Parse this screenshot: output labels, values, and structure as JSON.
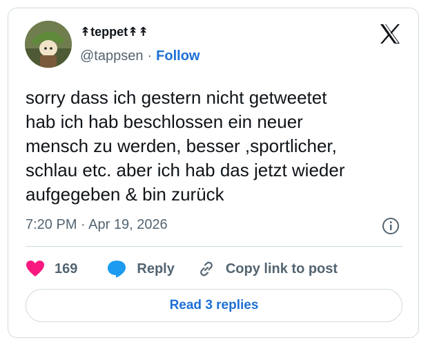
{
  "author": {
    "display_name": "↟teppet↟↟",
    "handle": "@tappsen",
    "separator": "·",
    "follow_label": "Follow"
  },
  "tweet": {
    "text": "sorry dass ich gestern nicht getweetet\nhab ich hab beschlossen ein neuer\nmensch zu werden, besser ,sportlicher,\nschlau etc. aber ich hab das jetzt wieder\naufgegeben & bin zurück",
    "timestamp": "7:20 PM · Apr 19, 2026"
  },
  "actions": {
    "like_count": "169",
    "reply_label": "Reply",
    "copy_label": "Copy link to post"
  },
  "read_replies_label": "Read 3 replies",
  "icons": [
    "avatar",
    "x-logo-icon",
    "info-icon",
    "heart-icon",
    "reply-bubble-icon",
    "link-icon"
  ],
  "colors": {
    "accent": "#1d6fd6",
    "like": "#f91880",
    "reply": "#1d9bf0",
    "muted": "#536471"
  }
}
